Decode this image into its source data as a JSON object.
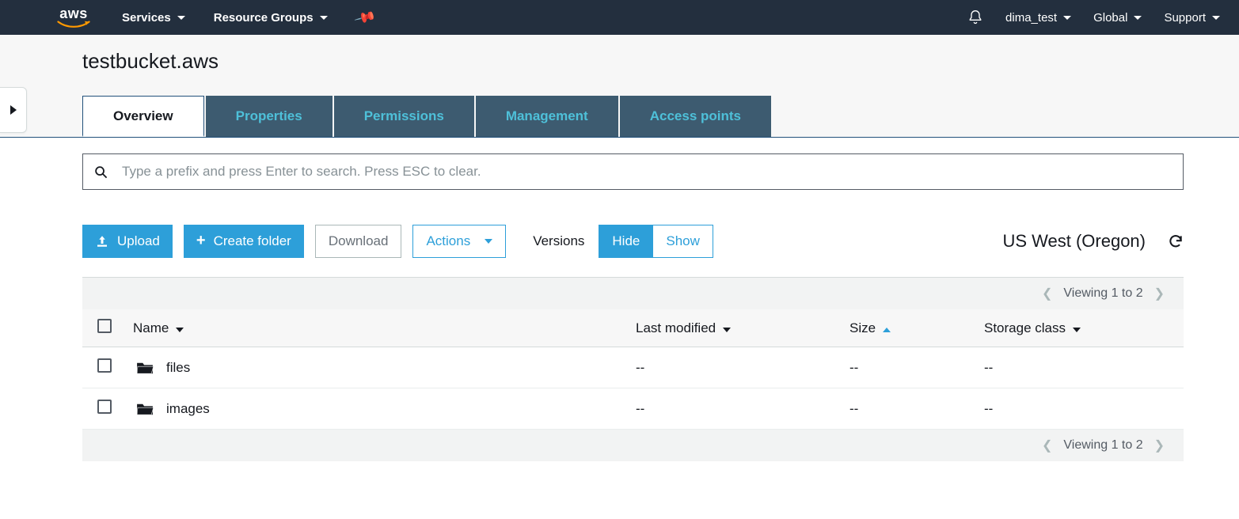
{
  "topnav": {
    "services": "Services",
    "resource_groups": "Resource Groups",
    "account": "dima_test",
    "region_selector": "Global",
    "support": "Support"
  },
  "page_title": "testbucket.aws",
  "tabs": [
    {
      "label": "Overview",
      "active": true
    },
    {
      "label": "Properties",
      "active": false
    },
    {
      "label": "Permissions",
      "active": false
    },
    {
      "label": "Management",
      "active": false
    },
    {
      "label": "Access points",
      "active": false
    }
  ],
  "search": {
    "placeholder": "Type a prefix and press Enter to search. Press ESC to clear."
  },
  "toolbar": {
    "upload": "Upload",
    "create_folder": "Create folder",
    "download": "Download",
    "actions": "Actions",
    "versions_label": "Versions",
    "hide": "Hide",
    "show": "Show",
    "region": "US West (Oregon)"
  },
  "paging": {
    "text": "Viewing 1 to 2"
  },
  "columns": {
    "name": "Name",
    "last_modified": "Last modified",
    "size": "Size",
    "storage_class": "Storage class"
  },
  "objects": [
    {
      "name": "files",
      "last_modified": "--",
      "size": "--",
      "storage_class": "--"
    },
    {
      "name": "images",
      "last_modified": "--",
      "size": "--",
      "storage_class": "--"
    }
  ]
}
